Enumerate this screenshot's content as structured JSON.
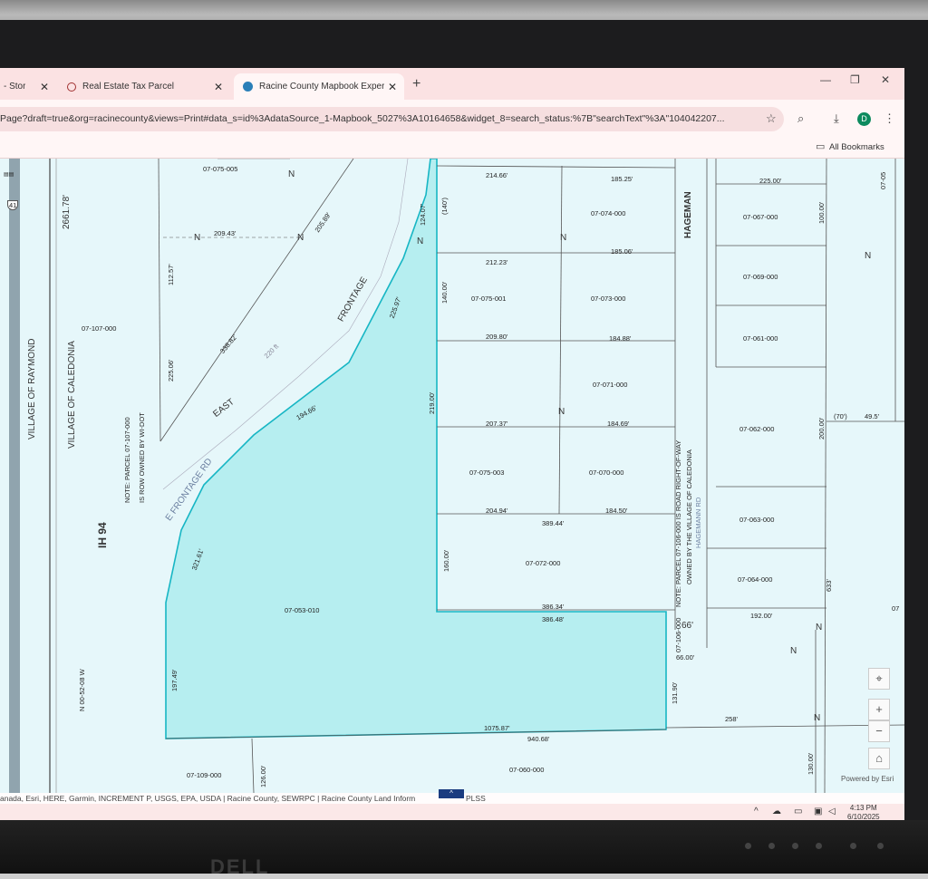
{
  "browser": {
    "tabs": [
      {
        "title": "- Stor",
        "active": false
      },
      {
        "title": "Real Estate Tax Parcel",
        "active": false
      },
      {
        "title": "Racine County Mapbook Exper",
        "active": true
      }
    ],
    "new_tab": "+",
    "url": "Page?draft=true&org=racinecounty&views=Print#data_s=id%3AdataSource_1-Mapbook_5027%3A10164658&widget_8=search_status:%7B\"searchText\"%3A\"104042207...",
    "bookmarks_label": "All Bookmarks",
    "profile_initial": "D",
    "window_controls": [
      "—",
      "❐",
      "✕"
    ]
  },
  "map": {
    "labels": {
      "highway_shield": "41",
      "ih94": "IH 94",
      "raymond": "VILLAGE OF RAYMOND",
      "caledonia": "VILLAGE OF CALEDONIA",
      "dist_2661": "2661.78'",
      "parcel_107": "07-107-000",
      "note_row": "NOTE: PARCEL 07-107-000",
      "note_row2": "IS ROW OWNED BY WI-DOT",
      "meridian": "N 00-52-08 W",
      "east": "EAST",
      "frontage": "FRONTAGE",
      "e_frontage_rd": "E FRONTAGE RD",
      "hageman": "HAGEMAN",
      "note_hageman": "NOTE: PARCEL 07-106-000 IS ROAD RIGHT-OF-WAY",
      "note_hageman2": "OWNED BY THE VILLAGE OF CALEDONIA",
      "hageman_rd": "HAGEMANN RD",
      "parcel_106": "07-106-000"
    },
    "parcels": [
      "07-075-005",
      "07-074-000",
      "07-075-001",
      "07-073-000",
      "07-071-000",
      "07-075-003",
      "07-070-000",
      "07-072-000",
      "07-053-010",
      "07-109-000",
      "07-060-000",
      "07-067-000",
      "07-069-000",
      "07-061-000",
      "07-062-000",
      "07-063-000",
      "07-064-000",
      "07-05",
      "07"
    ],
    "dims": [
      "209.43'",
      "112.57'",
      "225.06'",
      "338.82'",
      "220 ft",
      "205.89'",
      "225.97'",
      "194.66'",
      "321.61'",
      "197.49'",
      "214.66'",
      "185.25'",
      "185.06'",
      "212.23'",
      "209.80'",
      "184.88'",
      "207.37'",
      "184.69'",
      "204.94'",
      "184.50'",
      "389.44'",
      "386.34'",
      "386.48'",
      "1075.87'",
      "940.68'",
      "225.00'",
      "192.00'",
      "258'",
      "66'",
      "66.00'",
      "131.90'",
      "126.00'",
      "130.00'",
      "633'",
      "(70')",
      "49.5'",
      "124.07'",
      "140.00'",
      "(140')",
      "160.00'",
      "100.00'",
      "219.00'",
      "200.00'"
    ],
    "north": "N"
  },
  "controls": {
    "locate": "⌖",
    "zoom_in": "+",
    "zoom_out": "−",
    "home": "⌂"
  },
  "attribution": "anada, Esri, HERE, Garmin, INCREMENT P, USGS, EPA, USDA | Racine County, SEWRPC | Racine County Land Inform",
  "attribution_tail": "PLSS",
  "powered_by": "Powered by Esri",
  "taskbar": {
    "time": "4:13 PM",
    "date": "6/10/2025"
  },
  "monitor_brand": "DELL"
}
